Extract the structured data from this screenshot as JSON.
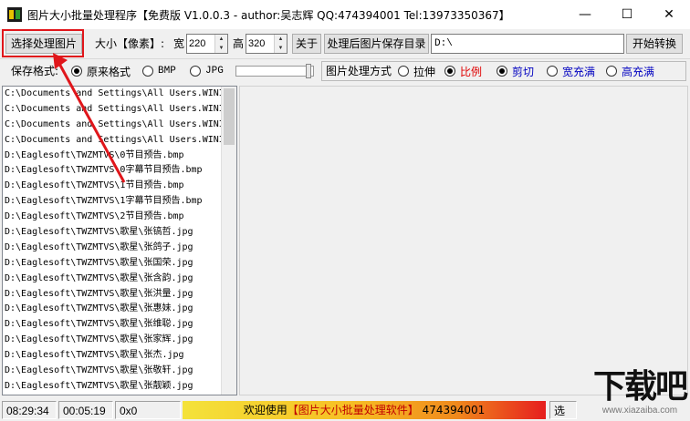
{
  "window": {
    "title": "图片大小批量处理程序【免费版 V1.0.0.3 - author:吴志辉  QQ:474394001 Tel:13973350367】",
    "controls": {
      "minimize": "—",
      "maximize": "☐",
      "close": "✕"
    }
  },
  "toolbar": {
    "select_images": "选择处理图片",
    "size_label": "大小【像素】:",
    "width_label": "宽",
    "width_value": "220",
    "height_label": "高",
    "height_value": "320",
    "about": "关于",
    "save_dir_button": "处理后图片保存目录",
    "save_dir_value": "D:\\",
    "start": "开始转换"
  },
  "options": {
    "save_format_label": "保存格式:",
    "formats": [
      {
        "label": "原来格式",
        "selected": true
      },
      {
        "label": "BMP",
        "selected": false
      },
      {
        "label": "JPG",
        "selected": false
      }
    ],
    "jpg_quality": 1.0,
    "method_label": "图片处理方式",
    "methods": [
      {
        "label": "拉伸",
        "selected": false,
        "color": "#000000"
      },
      {
        "label": "比例",
        "selected": true,
        "color": "#e00000"
      }
    ],
    "crops": [
      {
        "label": "剪切",
        "selected": true,
        "color": "#0000c0"
      },
      {
        "label": "宽充满",
        "selected": false,
        "color": "#0000c0"
      },
      {
        "label": "高充满",
        "selected": false,
        "color": "#0000c0"
      }
    ]
  },
  "files": [
    "C:\\Documents and Settings\\All Users.WINI",
    "C:\\Documents and Settings\\All Users.WINI",
    "C:\\Documents and Settings\\All Users.WINI",
    "C:\\Documents and Settings\\All Users.WINI",
    "D:\\Eaglesoft\\TWZMTVS\\0节目预告.bmp",
    "D:\\Eaglesoft\\TWZMTVS\\0字幕节目预告.bmp",
    "D:\\Eaglesoft\\TWZMTVS\\1节目预告.bmp",
    "D:\\Eaglesoft\\TWZMTVS\\1字幕节目预告.bmp",
    "D:\\Eaglesoft\\TWZMTVS\\2节目预告.bmp",
    "D:\\Eaglesoft\\TWZMTVS\\歌星\\张镐哲.jpg",
    "D:\\Eaglesoft\\TWZMTVS\\歌星\\张鸽子.jpg",
    "D:\\Eaglesoft\\TWZMTVS\\歌星\\张国荣.jpg",
    "D:\\Eaglesoft\\TWZMTVS\\歌星\\张含韵.jpg",
    "D:\\Eaglesoft\\TWZMTVS\\歌星\\张洪量.jpg",
    "D:\\Eaglesoft\\TWZMTVS\\歌星\\张惠妹.jpg",
    "D:\\Eaglesoft\\TWZMTVS\\歌星\\张维聪.jpg",
    "D:\\Eaglesoft\\TWZMTVS\\歌星\\张家辉.jpg",
    "D:\\Eaglesoft\\TWZMTVS\\歌星\\张杰.jpg",
    "D:\\Eaglesoft\\TWZMTVS\\歌星\\张敬轩.jpg",
    "D:\\Eaglesoft\\TWZMTVS\\歌星\\张靓颖.jpg"
  ],
  "status": {
    "clock": "08:29:34",
    "elapsed": "00:05:19",
    "hex": "0x0",
    "banner_prefix": "欢迎使用",
    "banner_em": "【图片大小批量处理软件】",
    "banner_qq": "474394001",
    "tail": "选"
  },
  "watermark": {
    "big": "下载吧",
    "small": "www.xiazaiba.com"
  },
  "colors": {
    "highlight": "#e0161b",
    "accent_red": "#e00000",
    "accent_blue": "#0000c0"
  }
}
